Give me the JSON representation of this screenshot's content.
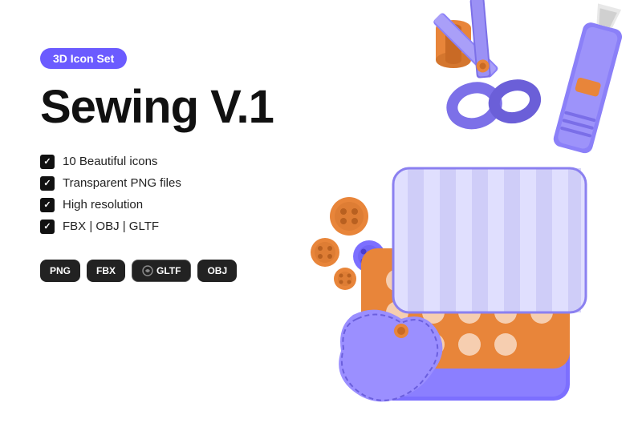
{
  "badge": {
    "label": "3D Icon Set"
  },
  "title": {
    "text": "Sewing V.1"
  },
  "features": [
    {
      "id": "feat1",
      "text": "10 Beautiful icons"
    },
    {
      "id": "feat2",
      "text": "Transparent PNG files"
    },
    {
      "id": "feat3",
      "text": "High resolution"
    },
    {
      "id": "feat4",
      "text": "FBX | OBJ | GLTF"
    }
  ],
  "formats": [
    {
      "id": "fmt1",
      "label": "PNG"
    },
    {
      "id": "fmt2",
      "label": "FBX"
    },
    {
      "id": "fmt3",
      "label": "GLTF",
      "icon": true
    },
    {
      "id": "fmt4",
      "label": "OBJ"
    }
  ],
  "colors": {
    "purple": "#7C6FFF",
    "orange": "#E8863A",
    "dark": "#111111",
    "badge_bg": "#6B5BFF"
  }
}
